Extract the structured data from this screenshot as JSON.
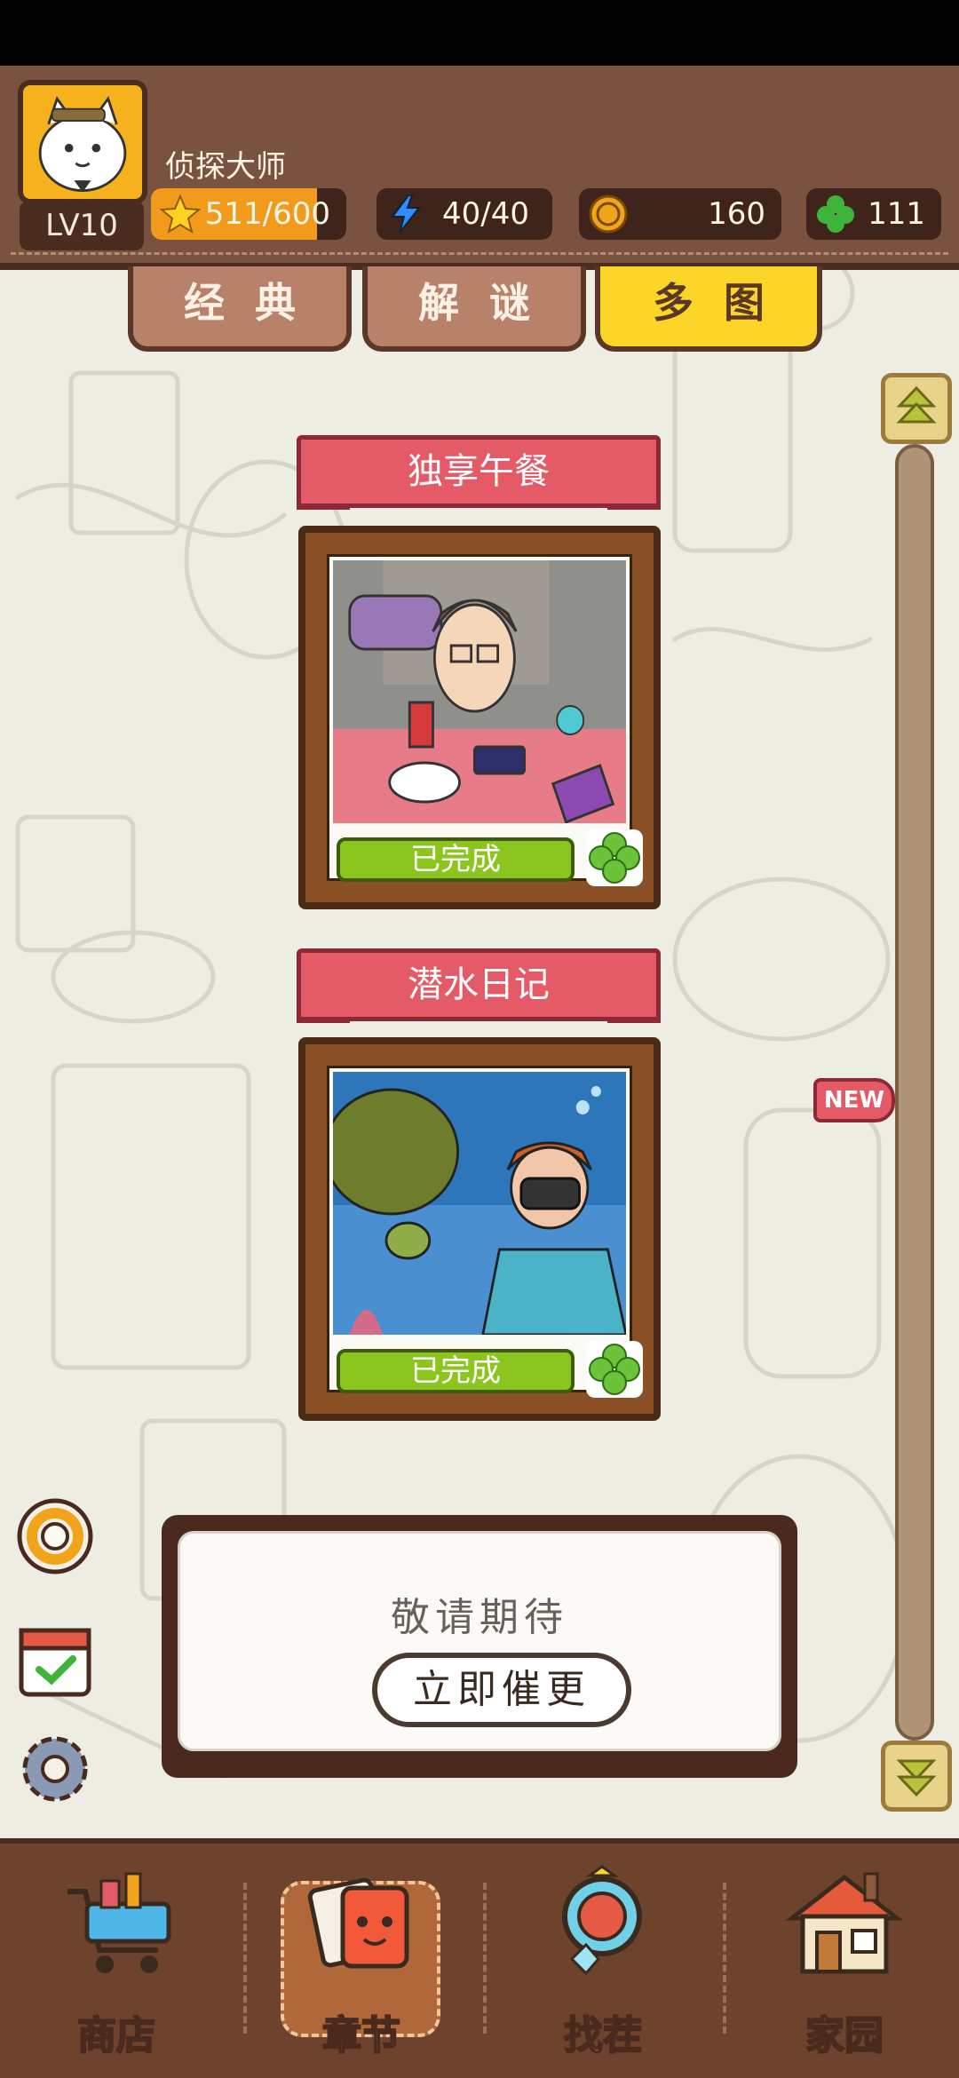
{
  "header": {
    "username": "侦探大师",
    "level": "LV10",
    "stars": "511/600",
    "stars_fraction": 0.85,
    "energy": "40/40",
    "coins": "160",
    "clovers": "111"
  },
  "tabs": [
    {
      "label": "经典",
      "active": false
    },
    {
      "label": "解谜",
      "active": false
    },
    {
      "label": "多图",
      "active": true
    }
  ],
  "chapters": [
    {
      "title": "独享午餐",
      "status": "已完成"
    },
    {
      "title": "潜水日记",
      "status": "已完成"
    }
  ],
  "new_tag": "NEW",
  "coming_soon": {
    "title": "敬请期待",
    "button": "立即催更"
  },
  "bottom_nav": [
    {
      "label": "商店",
      "active": false
    },
    {
      "label": "章节",
      "active": true
    },
    {
      "label": "找茬",
      "active": false
    },
    {
      "label": "家园",
      "active": false
    }
  ],
  "colors": {
    "header_bg": "#7a5240",
    "tab_active": "#fbd629",
    "ribbon": "#e45a67",
    "done_green": "#8cc51e",
    "nav_label": "#fbd629"
  },
  "icons": {
    "energy": "lightning-icon",
    "coin": "coin-icon",
    "clover": "clover-icon",
    "star": "star-icon"
  }
}
